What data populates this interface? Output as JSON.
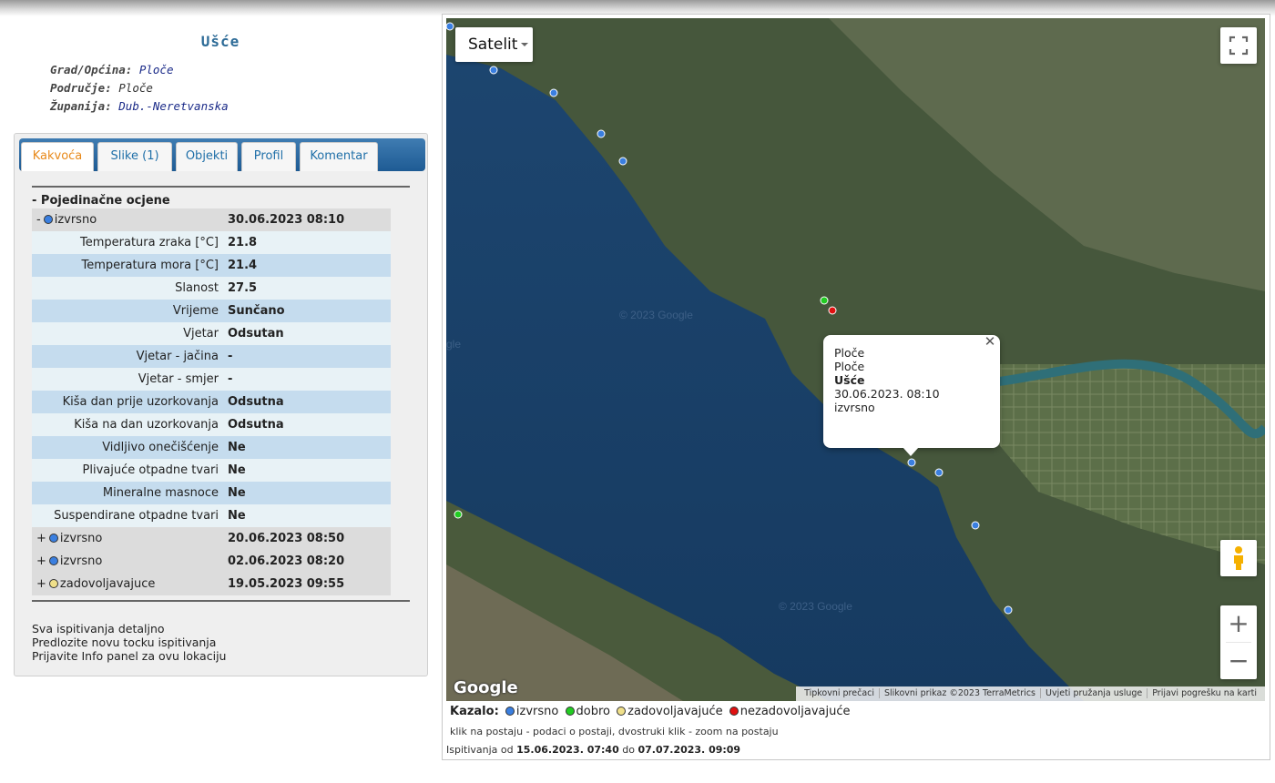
{
  "location": {
    "title": "Ušće",
    "meta": [
      {
        "key": "Grad/Općina:",
        "value": "Ploče"
      },
      {
        "key": "Područje:",
        "value": "Ploče"
      },
      {
        "key": "Županija:",
        "value": "Dub.-Neretvanska"
      }
    ]
  },
  "tabs": [
    {
      "label": "Kakvoća",
      "active": true
    },
    {
      "label": "Slike (1)",
      "active": false
    },
    {
      "label": "Objekti",
      "active": false
    },
    {
      "label": "Profil",
      "active": false
    },
    {
      "label": "Komentar",
      "active": false
    }
  ],
  "section_title": "- Pojedinačne ocjene",
  "latest": {
    "toggle": "-",
    "status": "izvrsno",
    "status_color": "#3a7fe0",
    "datetime": "30.06.2023 08:10"
  },
  "measurements": [
    {
      "label": "Temperatura zraka [°C]",
      "value": "21.8"
    },
    {
      "label": "Temperatura mora [°C]",
      "value": "21.4"
    },
    {
      "label": "Slanost",
      "value": "27.5"
    },
    {
      "label": "Vrijeme",
      "value": "Sunčano"
    },
    {
      "label": "Vjetar",
      "value": "Odsutan"
    },
    {
      "label": "Vjetar - jačina",
      "value": "-"
    },
    {
      "label": "Vjetar - smjer",
      "value": "-"
    },
    {
      "label": "Kiša dan prije uzorkovanja",
      "value": "Odsutna"
    },
    {
      "label": "Kiša na dan uzorkovanja",
      "value": "Odsutna"
    },
    {
      "label": "Vidljivo onečišćenje",
      "value": "Ne"
    },
    {
      "label": "Plivajuće otpadne tvari",
      "value": "Ne"
    },
    {
      "label": "Mineralne masnoce",
      "value": "Ne"
    },
    {
      "label": "Suspendirane otpadne tvari",
      "value": "Ne"
    }
  ],
  "history": [
    {
      "toggle": "+",
      "status": "izvrsno",
      "status_color": "#3a7fe0",
      "datetime": "20.06.2023 08:50"
    },
    {
      "toggle": "+",
      "status": "izvrsno",
      "status_color": "#3a7fe0",
      "datetime": "02.06.2023 08:20"
    },
    {
      "toggle": "+",
      "status": "zadovoljavajuce",
      "status_color": "#f0e08a",
      "datetime": "19.05.2023 09:55"
    }
  ],
  "links": [
    "Sva ispitivanja detaljno",
    "Predlozite novu tocku ispitivanja",
    "Prijavite Info panel za ovu lokaciju"
  ],
  "map": {
    "type_label": "Satelit",
    "logo": "Google",
    "watermark": "© 2023 Google",
    "watermark_short": "gle",
    "popup": {
      "line1": "Ploče",
      "line2": "Ploče",
      "name": "Ušće",
      "datetime": "30.06.2023. 08:10",
      "status": "izvrsno"
    },
    "attribution": [
      "Tipkovni prečaci",
      "Slikovni prikaz ©2023 TerraMetrics",
      "Uvjeti pružanja usluge",
      "Prijavi pogrešku na karti"
    ],
    "zoom_in": "+",
    "zoom_out": "−"
  },
  "legend": {
    "title": "Kazalo:",
    "items": [
      {
        "label": "izvrsno",
        "color": "#3a7fe0"
      },
      {
        "label": "dobro",
        "color": "#22cc22"
      },
      {
        "label": "zadovoljavajuće",
        "color": "#f0e08a"
      },
      {
        "label": "nezadovoljavajuće",
        "color": "#e01010"
      }
    ]
  },
  "note": "klik na postaju - podaci o postaji, dvostruki klik - zoom na postaju",
  "period": {
    "prefix": "Ispitivanja od",
    "from": "15.06.2023. 07:40",
    "mid": "do",
    "to": "07.07.2023. 09:09"
  }
}
